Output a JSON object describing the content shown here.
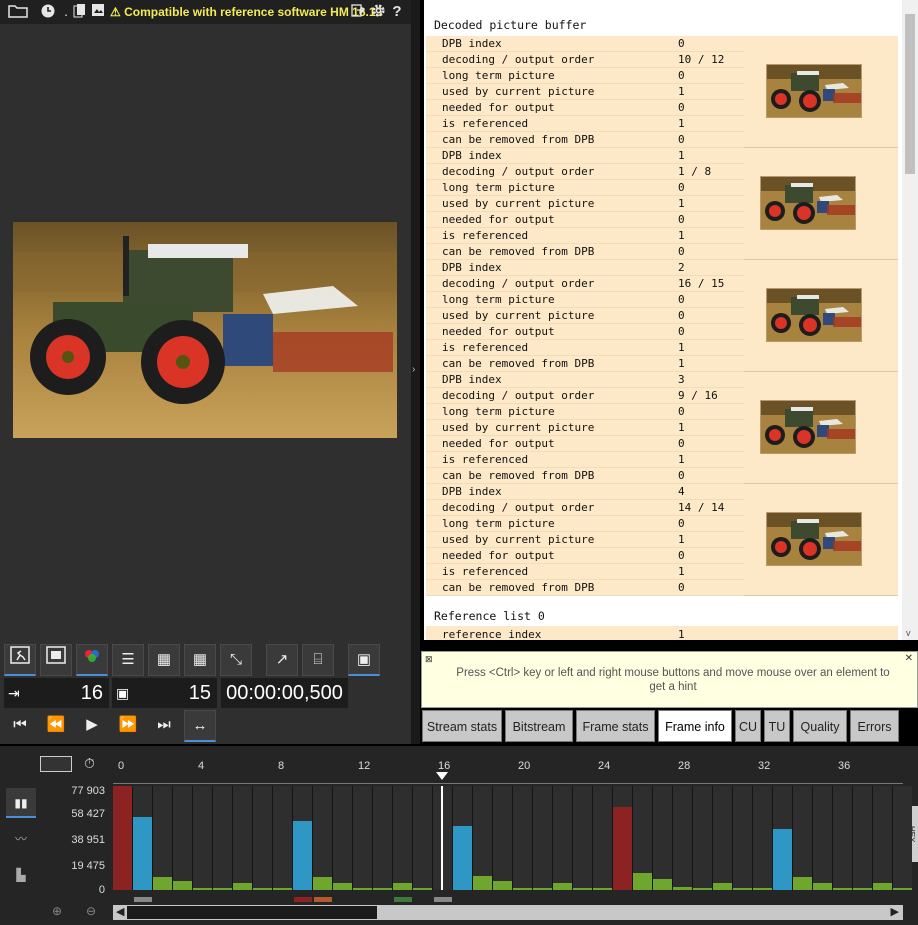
{
  "toolbar": {
    "compat_message": "Compatible with reference software HM 16.15",
    "icons": [
      "folder-open-icon",
      "clock-icon",
      "file-icon",
      "settings-icon",
      "help-icon"
    ]
  },
  "controls": {
    "frame_index": "16",
    "frame_count": "15",
    "timecode": "00:00:00,500"
  },
  "info": {
    "section_title": "Decoded picture buffer",
    "keys": [
      "DPB index",
      "decoding / output order",
      "long term picture",
      "used by current picture",
      "needed for output",
      "is referenced",
      "can be removed from DPB"
    ],
    "entries": [
      {
        "values": [
          "0",
          "10 / 12",
          "0",
          "1",
          "0",
          "1",
          "0"
        ]
      },
      {
        "values": [
          "1",
          "1 / 8",
          "0",
          "1",
          "0",
          "1",
          "0"
        ]
      },
      {
        "values": [
          "2",
          "16 / 15",
          "0",
          "0",
          "0",
          "1",
          "1"
        ]
      },
      {
        "values": [
          "3",
          "9 / 16",
          "0",
          "1",
          "0",
          "1",
          "0"
        ]
      },
      {
        "values": [
          "4",
          "14 / 14",
          "0",
          "1",
          "0",
          "1",
          "0"
        ]
      }
    ],
    "ref_title": "Reference list 0",
    "ref_key": "reference index",
    "ref_value": "1"
  },
  "hint": {
    "text": "Press <Ctrl> key or left and right mouse buttons and move mouse over an element to get a hint"
  },
  "tabs": [
    {
      "label": "Stream stats"
    },
    {
      "label": "Bitstream"
    },
    {
      "label": "Frame stats"
    },
    {
      "label": "Frame info",
      "active": true
    },
    {
      "label": "CU"
    },
    {
      "label": "TU"
    },
    {
      "label": "Quality"
    },
    {
      "label": "Errors"
    }
  ],
  "chart_data": {
    "type": "bar",
    "y_tick_labels": [
      "77 903",
      "58 427",
      "38 951",
      "19 475",
      "0"
    ],
    "x_tick_labels": [
      "0",
      "4",
      "8",
      "12",
      "16",
      "20",
      "24",
      "28",
      "32",
      "36"
    ],
    "ylim": [
      0,
      77903
    ],
    "current_frame": 16,
    "colors": {
      "I": "#8c2323",
      "P": "#2f97c4",
      "B": "#6fa62e",
      "empty": "#323232"
    },
    "frames": [
      {
        "x": 0,
        "value": 77903,
        "kind": "I"
      },
      {
        "x": 1,
        "value": 55000,
        "kind": "P"
      },
      {
        "x": 2,
        "value": 9500,
        "kind": "B"
      },
      {
        "x": 3,
        "value": 6500,
        "kind": "B"
      },
      {
        "x": 4,
        "value": 1500,
        "kind": "B"
      },
      {
        "x": 5,
        "value": 1500,
        "kind": "B"
      },
      {
        "x": 6,
        "value": 5500,
        "kind": "B"
      },
      {
        "x": 7,
        "value": 1500,
        "kind": "B"
      },
      {
        "x": 8,
        "value": 1500,
        "kind": "B"
      },
      {
        "x": 9,
        "value": 52000,
        "kind": "P"
      },
      {
        "x": 10,
        "value": 9500,
        "kind": "B"
      },
      {
        "x": 11,
        "value": 5500,
        "kind": "B"
      },
      {
        "x": 12,
        "value": 1500,
        "kind": "B"
      },
      {
        "x": 13,
        "value": 1500,
        "kind": "B"
      },
      {
        "x": 14,
        "value": 5500,
        "kind": "B"
      },
      {
        "x": 15,
        "value": 1500,
        "kind": "B"
      },
      {
        "x": 16,
        "value": 0,
        "kind": "empty"
      },
      {
        "x": 17,
        "value": 48000,
        "kind": "P"
      },
      {
        "x": 18,
        "value": 10500,
        "kind": "B"
      },
      {
        "x": 19,
        "value": 6500,
        "kind": "B"
      },
      {
        "x": 20,
        "value": 1500,
        "kind": "B"
      },
      {
        "x": 21,
        "value": 1500,
        "kind": "B"
      },
      {
        "x": 22,
        "value": 5500,
        "kind": "B"
      },
      {
        "x": 23,
        "value": 1500,
        "kind": "B"
      },
      {
        "x": 24,
        "value": 1500,
        "kind": "B"
      },
      {
        "x": 25,
        "value": 62000,
        "kind": "I"
      },
      {
        "x": 26,
        "value": 12500,
        "kind": "B"
      },
      {
        "x": 27,
        "value": 8500,
        "kind": "B"
      },
      {
        "x": 28,
        "value": 2500,
        "kind": "B"
      },
      {
        "x": 29,
        "value": 1500,
        "kind": "B"
      },
      {
        "x": 30,
        "value": 5500,
        "kind": "B"
      },
      {
        "x": 31,
        "value": 1500,
        "kind": "B"
      },
      {
        "x": 32,
        "value": 1500,
        "kind": "B"
      },
      {
        "x": 33,
        "value": 46000,
        "kind": "P"
      },
      {
        "x": 34,
        "value": 9500,
        "kind": "B"
      },
      {
        "x": 35,
        "value": 5500,
        "kind": "B"
      },
      {
        "x": 36,
        "value": 1500,
        "kind": "B"
      },
      {
        "x": 37,
        "value": 1500,
        "kind": "B"
      },
      {
        "x": 38,
        "value": 5500,
        "kind": "B"
      },
      {
        "x": 39,
        "value": 1500,
        "kind": "B"
      }
    ]
  }
}
